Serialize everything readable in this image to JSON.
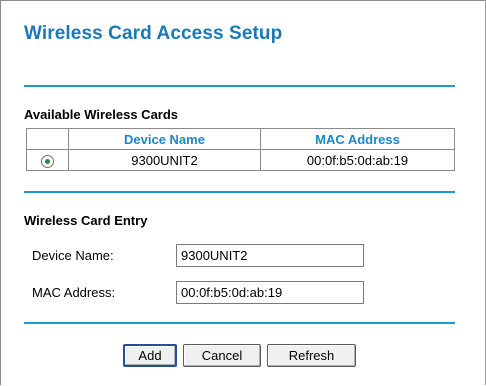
{
  "page": {
    "title": "Wireless Card Access Setup"
  },
  "available": {
    "label": "Available Wireless Cards",
    "headers": [
      "",
      "Device Name",
      "MAC Address"
    ],
    "rows": [
      {
        "selected": true,
        "device_name": "9300UNIT2",
        "mac": "00:0f:b5:0d:ab:19"
      }
    ]
  },
  "entry": {
    "label": "Wireless Card Entry",
    "device_name_label": "Device Name:",
    "device_name_value": "9300UNIT2",
    "mac_label": "MAC Address:",
    "mac_value": "00:0f:b5:0d:ab:19"
  },
  "buttons": {
    "add": "Add",
    "cancel": "Cancel",
    "refresh": "Refresh"
  },
  "colors": {
    "accent": "#1a7ab8",
    "rule": "#1a9ad2"
  }
}
